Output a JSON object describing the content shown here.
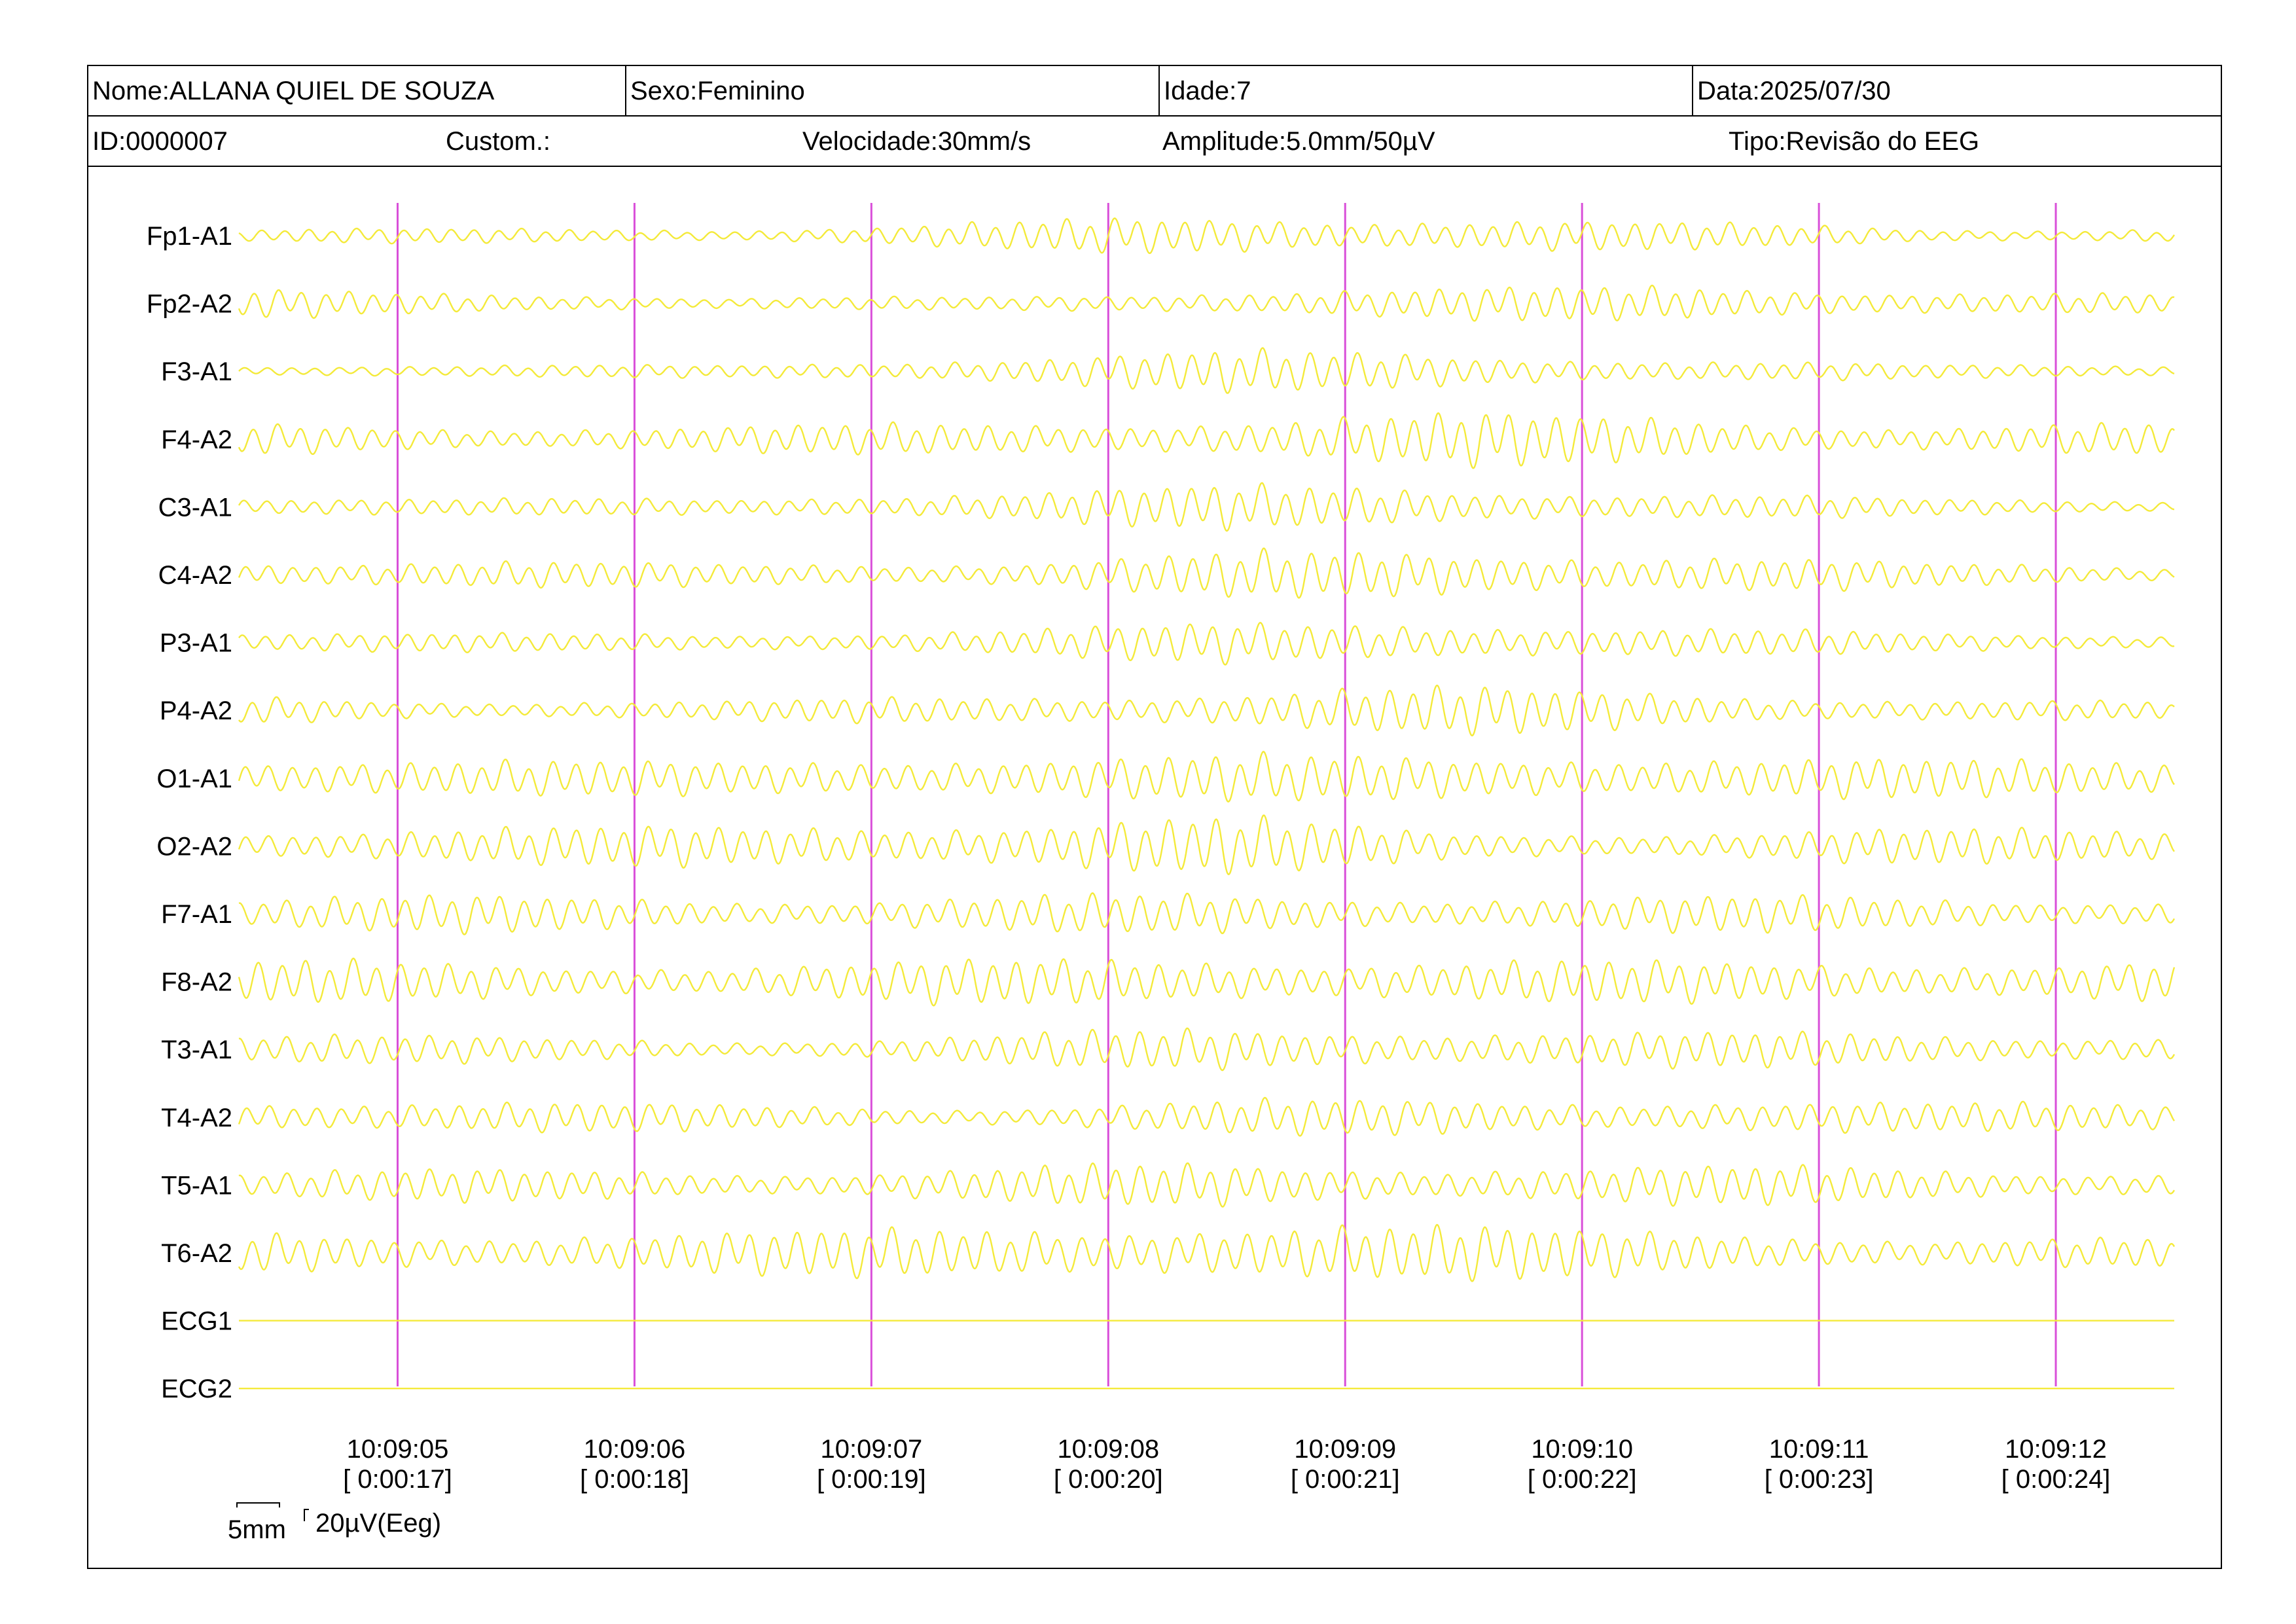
{
  "header": {
    "nome": "Nome:ALLANA QUIEL DE SOUZA",
    "sexo": "Sexo:Feminino",
    "idade": "Idade:7",
    "data": "Data:2025/07/30",
    "id": "ID:0000007",
    "custom": "Custom.:",
    "velocidade": "Velocidade:30mm/s",
    "amplitude": "Amplitude:5.0mm/50µV",
    "tipo": "Tipo:Revisão do EEG"
  },
  "colors": {
    "trace": "#f4ea3a",
    "marker": "#d94fd9",
    "frame": "#000000",
    "background": "#ffffff"
  },
  "scale_bar": {
    "time": "5mm",
    "amplitude": "20µV(Eeg)"
  },
  "chart_data": {
    "type": "line",
    "title": "",
    "xlabel": "",
    "ylabel": "",
    "time_markers": [
      {
        "clock": "10:09:05",
        "elapsed": "[ 0:00:17]"
      },
      {
        "clock": "10:09:06",
        "elapsed": "[ 0:00:18]"
      },
      {
        "clock": "10:09:07",
        "elapsed": "[ 0:00:19]"
      },
      {
        "clock": "10:09:08",
        "elapsed": "[ 0:00:20]"
      },
      {
        "clock": "10:09:09",
        "elapsed": "[ 0:00:21]"
      },
      {
        "clock": "10:09:10",
        "elapsed": "[ 0:00:22]"
      },
      {
        "clock": "10:09:11",
        "elapsed": "[ 0:00:23]"
      },
      {
        "clock": "10:09:12",
        "elapsed": "[ 0:00:24]"
      }
    ],
    "x_range_seconds": [
      16.33,
      24.5
    ],
    "series": [
      {
        "name": "Fp1-A1",
        "freq_hz": 10,
        "envelope": [
          0.25,
          0.25,
          0.3,
          0.45,
          0.7,
          0.75,
          0.45,
          0.3,
          0.3
        ]
      },
      {
        "name": "Fp2-A2",
        "freq_hz": 10,
        "envelope": [
          0.55,
          0.45,
          0.2,
          0.25,
          0.45,
          0.6,
          0.7,
          0.45,
          0.35
        ]
      },
      {
        "name": "F3-A1",
        "freq_hz": 10,
        "envelope": [
          0.25,
          0.2,
          0.25,
          0.5,
          0.75,
          0.75,
          0.4,
          0.25,
          0.25
        ]
      },
      {
        "name": "F4-A2",
        "freq_hz": 10,
        "envelope": [
          0.55,
          0.5,
          0.5,
          0.55,
          0.8,
          0.95,
          0.85,
          0.5,
          0.55
        ]
      },
      {
        "name": "C3-A1",
        "freq_hz": 10,
        "envelope": [
          0.45,
          0.3,
          0.3,
          0.6,
          0.8,
          0.75,
          0.5,
          0.3,
          0.25
        ]
      },
      {
        "name": "C4-A2",
        "freq_hz": 10,
        "envelope": [
          0.6,
          0.5,
          0.4,
          0.5,
          0.8,
          0.9,
          0.8,
          0.4,
          0.3
        ]
      },
      {
        "name": "P3-A1",
        "freq_hz": 10,
        "envelope": [
          0.45,
          0.35,
          0.3,
          0.5,
          0.75,
          0.75,
          0.55,
          0.35,
          0.3
        ]
      },
      {
        "name": "P4-A2",
        "freq_hz": 10,
        "envelope": [
          0.5,
          0.4,
          0.35,
          0.5,
          0.75,
          0.85,
          0.75,
          0.4,
          0.3
        ]
      },
      {
        "name": "O1-A1",
        "freq_hz": 10,
        "envelope": [
          0.75,
          0.7,
          0.65,
          0.75,
          0.9,
          0.9,
          0.75,
          0.75,
          0.7
        ]
      },
      {
        "name": "O2-A2",
        "freq_hz": 10,
        "envelope": [
          0.65,
          0.7,
          0.75,
          0.9,
          1.1,
          0.6,
          0.5,
          0.65,
          0.7
        ]
      },
      {
        "name": "F7-A1",
        "freq_hz": 10,
        "envelope": [
          0.65,
          0.65,
          0.6,
          0.65,
          0.7,
          0.7,
          0.65,
          0.6,
          0.6
        ]
      },
      {
        "name": "F8-A2",
        "freq_hz": 10,
        "envelope": [
          0.8,
          0.7,
          0.65,
          0.8,
          0.9,
          0.8,
          0.75,
          0.75,
          0.8
        ]
      },
      {
        "name": "T3-A1",
        "freq_hz": 10,
        "envelope": [
          0.65,
          0.45,
          0.35,
          0.55,
          0.75,
          0.8,
          0.65,
          0.55,
          0.6
        ]
      },
      {
        "name": "T4-A2",
        "freq_hz": 10,
        "envelope": [
          0.7,
          0.6,
          0.45,
          0.4,
          0.6,
          0.7,
          0.65,
          0.5,
          0.6
        ]
      },
      {
        "name": "T5-A1",
        "freq_hz": 10,
        "envelope": [
          0.6,
          0.55,
          0.55,
          0.65,
          0.75,
          0.8,
          0.7,
          0.6,
          0.6
        ]
      },
      {
        "name": "T6-A2",
        "freq_hz": 10,
        "envelope": [
          0.75,
          0.7,
          0.8,
          0.95,
          1.1,
          1.0,
          0.95,
          0.5,
          0.55
        ]
      },
      {
        "name": "ECG1",
        "freq_hz": 0,
        "envelope": [
          0,
          0,
          0,
          0,
          0,
          0,
          0,
          0,
          0
        ]
      },
      {
        "name": "ECG2",
        "freq_hz": 0,
        "envelope": [
          0,
          0,
          0,
          0,
          0,
          0,
          0,
          0,
          0
        ]
      }
    ]
  }
}
